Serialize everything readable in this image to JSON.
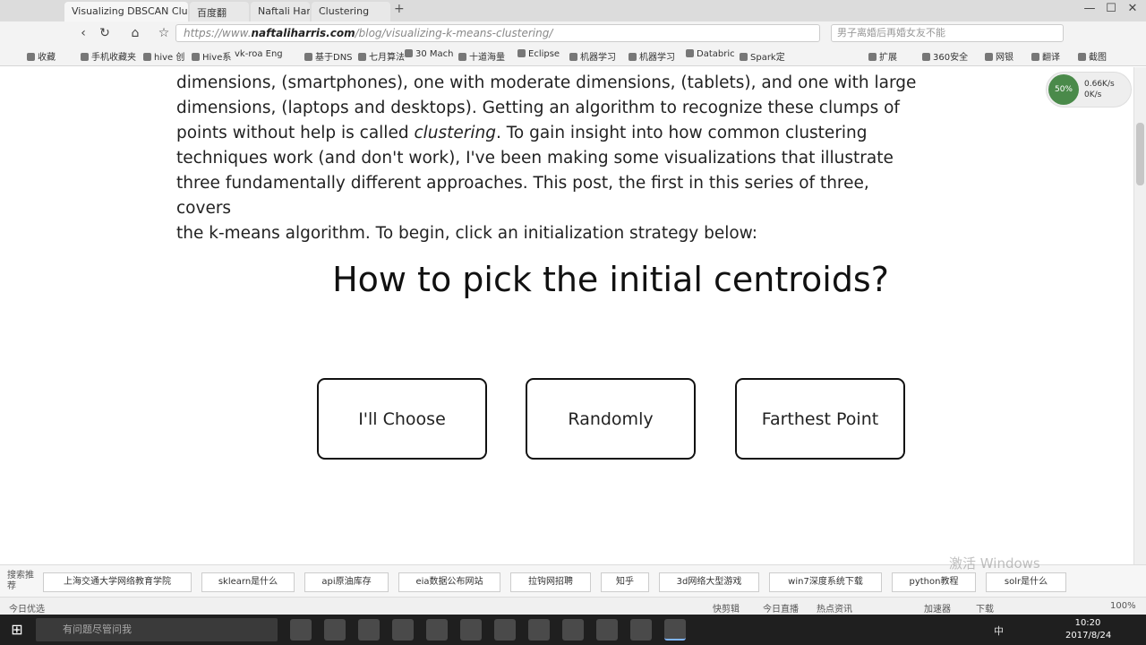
{
  "browser": {
    "tabs": [
      {
        "label": "Visualizing DBSCAN Clust"
      },
      {
        "label": "百度翻"
      },
      {
        "label": "Naftali Harris"
      },
      {
        "label": "Clustering"
      }
    ],
    "new_tab": "+",
    "url_prefix": "https://www.",
    "url_host": "naftaliharris.com",
    "url_path": "/blog/visualizing-k-means-clustering/",
    "search_box": "男子离婚后再婚女友不能",
    "window_controls": {
      "minimize": "—",
      "maximize": "☐",
      "close": "✕"
    }
  },
  "bookmarks": [
    {
      "label": "收藏"
    },
    {
      "label": "手机收藏夹"
    },
    {
      "label": "hive 创"
    },
    {
      "label": "Hive系"
    },
    {
      "label": "vk-roa Eng"
    },
    {
      "label": "基于DNS"
    },
    {
      "label": "七月算法"
    },
    {
      "label": "30 Mach"
    },
    {
      "label": "十道海量"
    },
    {
      "label": "Eclipse"
    },
    {
      "label": "机器学习"
    },
    {
      "label": "机器学习"
    },
    {
      "label": "Databric"
    },
    {
      "label": "Spark定"
    },
    {
      "label": "扩展"
    },
    {
      "label": "360安全"
    },
    {
      "label": "网银"
    },
    {
      "label": "翻译"
    },
    {
      "label": "截图"
    }
  ],
  "article": {
    "paragraph_lines": [
      "dimensions, (smartphones), one with moderate dimensions, (tablets), and one with large",
      "dimensions, (laptops and desktops). Getting an algorithm to recognize these clumps of",
      "points without help is called ",
      "clustering",
      ". To gain insight into how common clustering",
      "techniques work (and don't work), I've been making some visualizations that illustrate",
      "three fundamentally different approaches. This post, the first in this series of three, covers",
      "the k-means algorithm. To begin, click an initialization strategy below:"
    ],
    "heading": "How to pick the initial centroids?",
    "choices": [
      {
        "label": "I'll Choose"
      },
      {
        "label": "Randomly"
      },
      {
        "label": "Farthest Point"
      }
    ]
  },
  "speed_widget": {
    "percent": "50%",
    "up": "0.66K/s",
    "down": "0K/s"
  },
  "suggestions": {
    "label": "搜索推荐",
    "items": [
      {
        "label": "上海交通大学网络教育学院"
      },
      {
        "label": "sklearn是什么"
      },
      {
        "label": "api原油库存"
      },
      {
        "label": "eia数据公布网站"
      },
      {
        "label": "拉钩网招聘"
      },
      {
        "label": "知乎"
      },
      {
        "label": "3d网络大型游戏"
      },
      {
        "label": "win7深度系统下载"
      },
      {
        "label": "python教程"
      },
      {
        "label": "solr是什么"
      }
    ]
  },
  "watermark": "激活 Windows",
  "status": {
    "left": "今日优选",
    "items": [
      {
        "label": "快剪辑"
      },
      {
        "label": "今日直播"
      },
      {
        "label": "热点资讯"
      },
      {
        "label": "加速器"
      },
      {
        "label": "下载"
      },
      {
        "label": "100%"
      }
    ]
  },
  "taskbar": {
    "search_placeholder": "有问题尽管问我",
    "time": "10:20",
    "date": "2017/8/24",
    "ime": "中"
  }
}
